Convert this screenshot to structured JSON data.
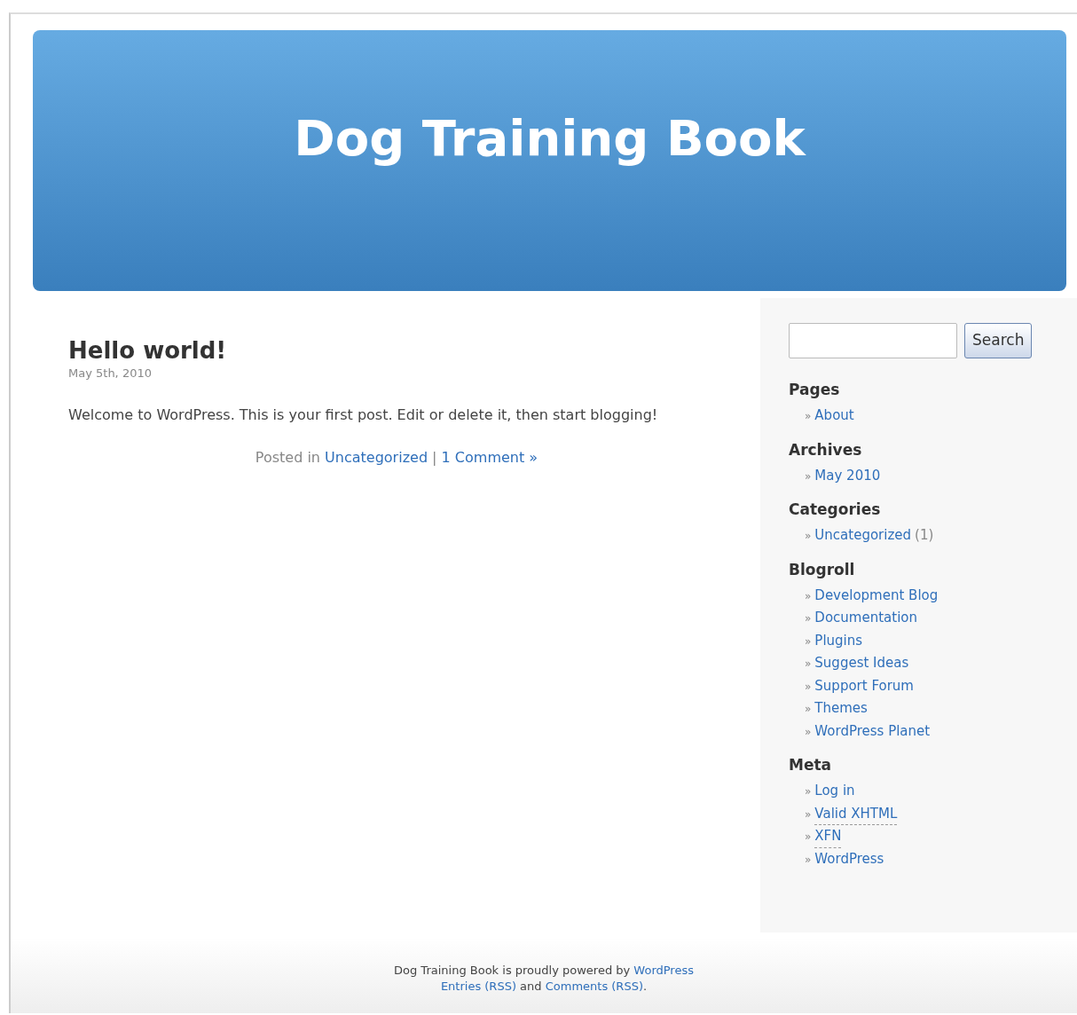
{
  "header": {
    "title": "Dog Training Book"
  },
  "post": {
    "title": "Hello world!",
    "date": "May 5th, 2010",
    "body": "Welcome to WordPress. This is your first post. Edit or delete it, then start blogging!",
    "meta": [
      {
        "text": "Posted in ",
        "link": false
      },
      {
        "text": "Uncategorized",
        "link": true
      },
      {
        "text": " | ",
        "link": false
      },
      {
        "text": "1 Comment »",
        "link": true
      }
    ]
  },
  "search": {
    "button": "Search"
  },
  "sidebar": [
    {
      "heading": "Pages",
      "items": [
        {
          "marker": "»",
          "label": "About"
        }
      ]
    },
    {
      "heading": "Archives",
      "items": [
        {
          "marker": "»",
          "label": "May 2010"
        }
      ]
    },
    {
      "heading": "Categories",
      "items": [
        {
          "marker": "»",
          "label": "Uncategorized",
          "count": "(1)"
        }
      ]
    },
    {
      "heading": "Blogroll",
      "items": [
        {
          "marker": "»",
          "label": "Development Blog"
        },
        {
          "marker": "»",
          "label": "Documentation"
        },
        {
          "marker": "»",
          "label": "Plugins"
        },
        {
          "marker": "»",
          "label": "Suggest Ideas"
        },
        {
          "marker": "»",
          "label": "Support Forum"
        },
        {
          "marker": "»",
          "label": "Themes"
        },
        {
          "marker": "»",
          "label": "WordPress Planet"
        }
      ]
    },
    {
      "heading": "Meta",
      "items": [
        {
          "marker": "»",
          "label": "Log in"
        },
        {
          "marker": "»",
          "label": "Valid XHTML",
          "abbr": true
        },
        {
          "marker": "»",
          "label": "XFN",
          "abbr": true
        },
        {
          "marker": "»",
          "label": "WordPress"
        }
      ]
    }
  ],
  "footer": {
    "lines": [
      [
        {
          "text": "Dog Training Book is proudly powered by ",
          "link": false
        },
        {
          "text": "WordPress",
          "link": true
        }
      ],
      [
        {
          "text": "Entries (RSS)",
          "link": true
        },
        {
          "text": " and ",
          "link": false
        },
        {
          "text": "Comments (RSS)",
          "link": true
        },
        {
          "text": ".",
          "link": false
        }
      ]
    ]
  }
}
